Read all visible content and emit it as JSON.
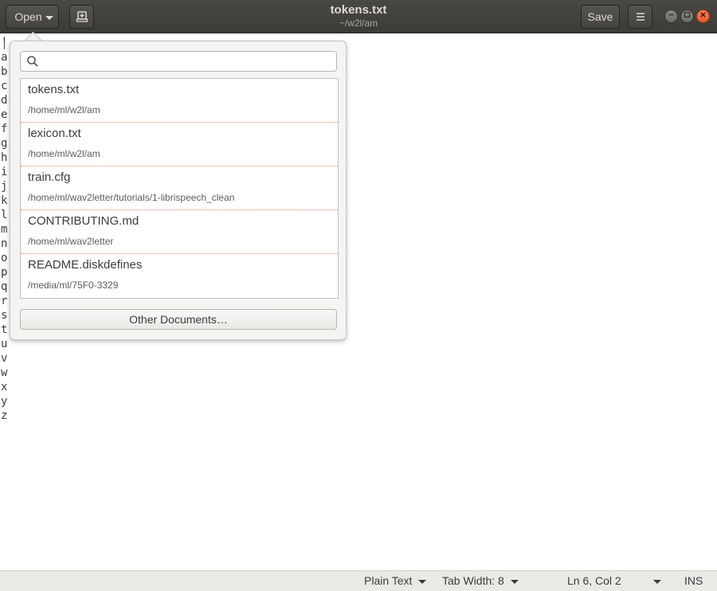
{
  "header": {
    "open_label": "Open",
    "title": "tokens.txt",
    "subtitle": "~/w2l/am",
    "save_label": "Save"
  },
  "editor": {
    "lines": [
      "'",
      "a",
      "b",
      "c",
      "d",
      "e",
      "f",
      "g",
      "h",
      "i",
      "j",
      "k",
      "l",
      "m",
      "n",
      "o",
      "p",
      "q",
      "r",
      "s",
      "t",
      "u",
      "v",
      "w",
      "x",
      "y",
      "z"
    ]
  },
  "popover": {
    "search_placeholder": "",
    "recent_files": [
      {
        "name": "tokens.txt",
        "path": "/home/ml/w2l/am"
      },
      {
        "name": "lexicon.txt",
        "path": "/home/ml/w2l/am"
      },
      {
        "name": "train.cfg",
        "path": "/home/ml/wav2letter/tutorials/1-librispeech_clean"
      },
      {
        "name": "CONTRIBUTING.md",
        "path": "/home/ml/wav2letter"
      },
      {
        "name": "README.diskdefines",
        "path": "/media/ml/75F0-3329"
      }
    ],
    "other_documents_label": "Other Documents…"
  },
  "statusbar": {
    "language": "Plain Text",
    "tab_width": "Tab Width: 8",
    "position": "Ln 6, Col 2",
    "mode": "INS"
  },
  "colors": {
    "headerbar": "#3c3b37",
    "close_button": "#e6552e",
    "row_separator": "#d98a6a"
  }
}
